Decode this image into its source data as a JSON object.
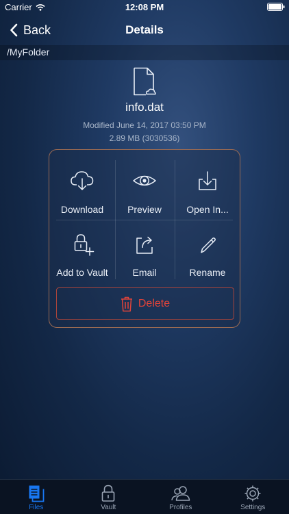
{
  "status_bar": {
    "carrier": "Carrier",
    "time": "12:08 PM"
  },
  "nav": {
    "back_label": "Back",
    "title": "Details"
  },
  "path": "/MyFolder",
  "file": {
    "name": "info.dat",
    "modified": "Modified June 14, 2017 03:50 PM",
    "size": "2.89 MB (3030536)"
  },
  "actions": {
    "download": "Download",
    "preview": "Preview",
    "open_in": "Open In...",
    "add_to_vault": "Add to Vault",
    "email": "Email",
    "rename": "Rename",
    "delete": "Delete"
  },
  "tabs": [
    {
      "label": "Files",
      "active": true
    },
    {
      "label": "Vault",
      "active": false
    },
    {
      "label": "Profiles",
      "active": false
    },
    {
      "label": "Settings",
      "active": false
    }
  ],
  "colors": {
    "accent": "#1877f2",
    "delete": "#e2443a",
    "panel_border": "#9a6a52"
  }
}
